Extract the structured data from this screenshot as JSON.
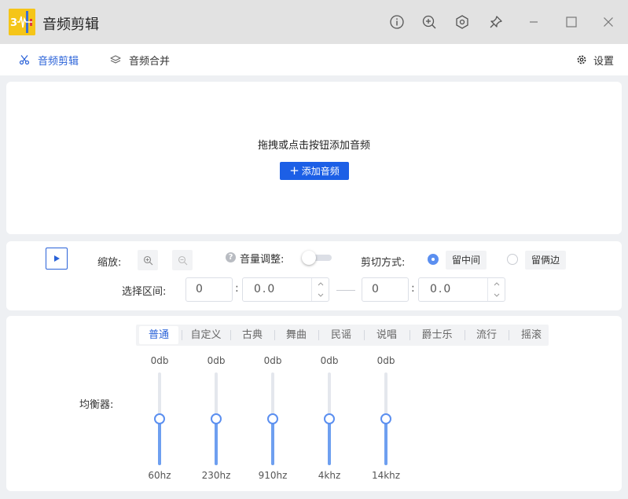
{
  "window": {
    "title": "音频剪辑",
    "logo_text": "3",
    "buttons": [
      "info",
      "zoom",
      "settings",
      "pin",
      "minimize",
      "maximize",
      "close"
    ]
  },
  "nav": {
    "tabs": [
      {
        "label": "音频剪辑",
        "active": true
      },
      {
        "label": "音频合并",
        "active": false
      }
    ],
    "settings_label": "设置"
  },
  "drop_zone": {
    "hint": "拖拽或点击按钮添加音频",
    "add_button_label": "添加音频"
  },
  "controls": {
    "zoom_label": "缩放:",
    "volume_label": "音量调整:",
    "volume_enabled": false,
    "cut_mode_label": "剪切方式:",
    "cut_modes": [
      {
        "label": "留中间",
        "checked": true
      },
      {
        "label": "留俩边",
        "checked": false
      }
    ],
    "range_label": "选择区间:",
    "start": {
      "seconds": "0",
      "fraction": "0.0"
    },
    "end": {
      "seconds": "0",
      "fraction": "0.0"
    },
    "colon": ":"
  },
  "equalizer": {
    "label": "均衡器:",
    "presets": [
      "普通",
      "自定义",
      "古典",
      "舞曲",
      "民谣",
      "说唱",
      "爵士乐",
      "流行",
      "摇滚"
    ],
    "active_preset": 0,
    "bands": [
      {
        "freq": "60hz",
        "value": "0db",
        "level": 0.5
      },
      {
        "freq": "230hz",
        "value": "0db",
        "level": 0.5
      },
      {
        "freq": "910hz",
        "value": "0db",
        "level": 0.5
      },
      {
        "freq": "4khz",
        "value": "0db",
        "level": 0.5
      },
      {
        "freq": "14khz",
        "value": "0db",
        "level": 0.5
      }
    ]
  },
  "colors": {
    "accent": "#2a62d8",
    "button_blue": "#1c5fe6",
    "slider_blue": "#6e9ff0"
  }
}
